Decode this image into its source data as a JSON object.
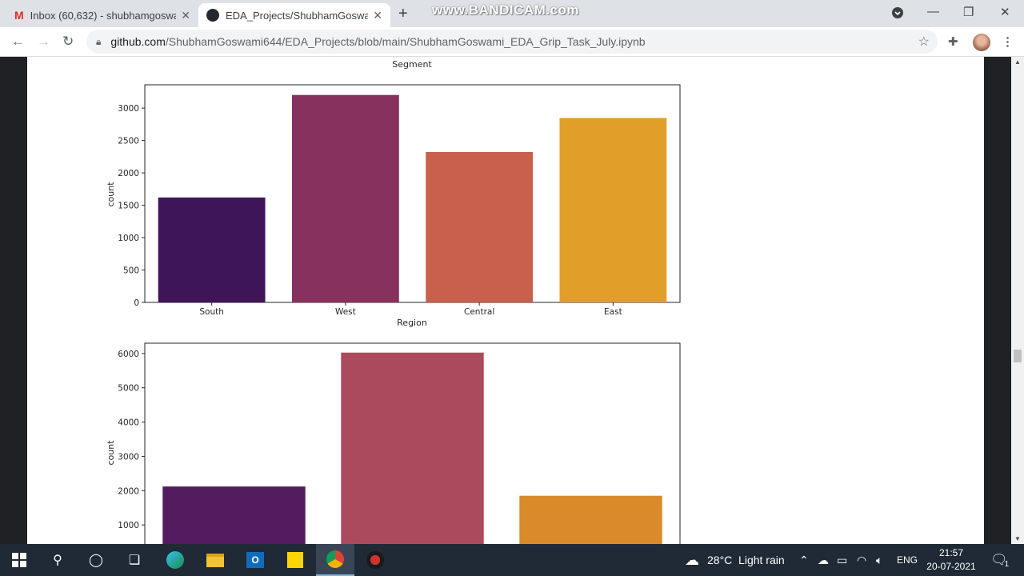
{
  "browser": {
    "tabs": [
      {
        "title": "Inbox (60,632) - shubhamgoswa",
        "icon": "gmail-icon"
      },
      {
        "title": "EDA_Projects/ShubhamGoswami",
        "icon": "github-icon"
      }
    ],
    "new_tab": "+",
    "watermark": "www.BANDICAM.com",
    "url_host": "github.com",
    "url_path": "/ShubhamGoswami644/EDA_Projects/blob/main/ShubhamGoswami_EDA_Grip_Task_July.ipynb"
  },
  "notebook": {
    "prev_plot_xlabel": "Segment"
  },
  "chart_data": [
    {
      "type": "bar",
      "categories": [
        "South",
        "West",
        "Central",
        "East"
      ],
      "values": [
        1620,
        3203,
        2323,
        2848
      ],
      "colors": [
        "#3e1558",
        "#87315f",
        "#c9604d",
        "#e19f2a"
      ],
      "xlabel": "Region",
      "ylabel": "count",
      "yticks": [
        "0",
        "500",
        "1000",
        "1500",
        "2000",
        "2500",
        "3000"
      ],
      "ylim": [
        0,
        3360
      ]
    },
    {
      "type": "bar",
      "categories": [
        "",
        "",
        ""
      ],
      "values": [
        2121,
        6026,
        1850
      ],
      "colors": [
        "#521c5f",
        "#ab4a5c",
        "#da8a2a"
      ],
      "ylabel": "count",
      "yticks": [
        "1000",
        "2000",
        "3000",
        "4000",
        "5000",
        "6000"
      ],
      "ylim": [
        0,
        6300
      ]
    }
  ],
  "taskbar": {
    "weather": "28°C  Light rain",
    "language": "ENG",
    "time": "21:57",
    "date": "20-07-2021",
    "notifications": "1"
  }
}
